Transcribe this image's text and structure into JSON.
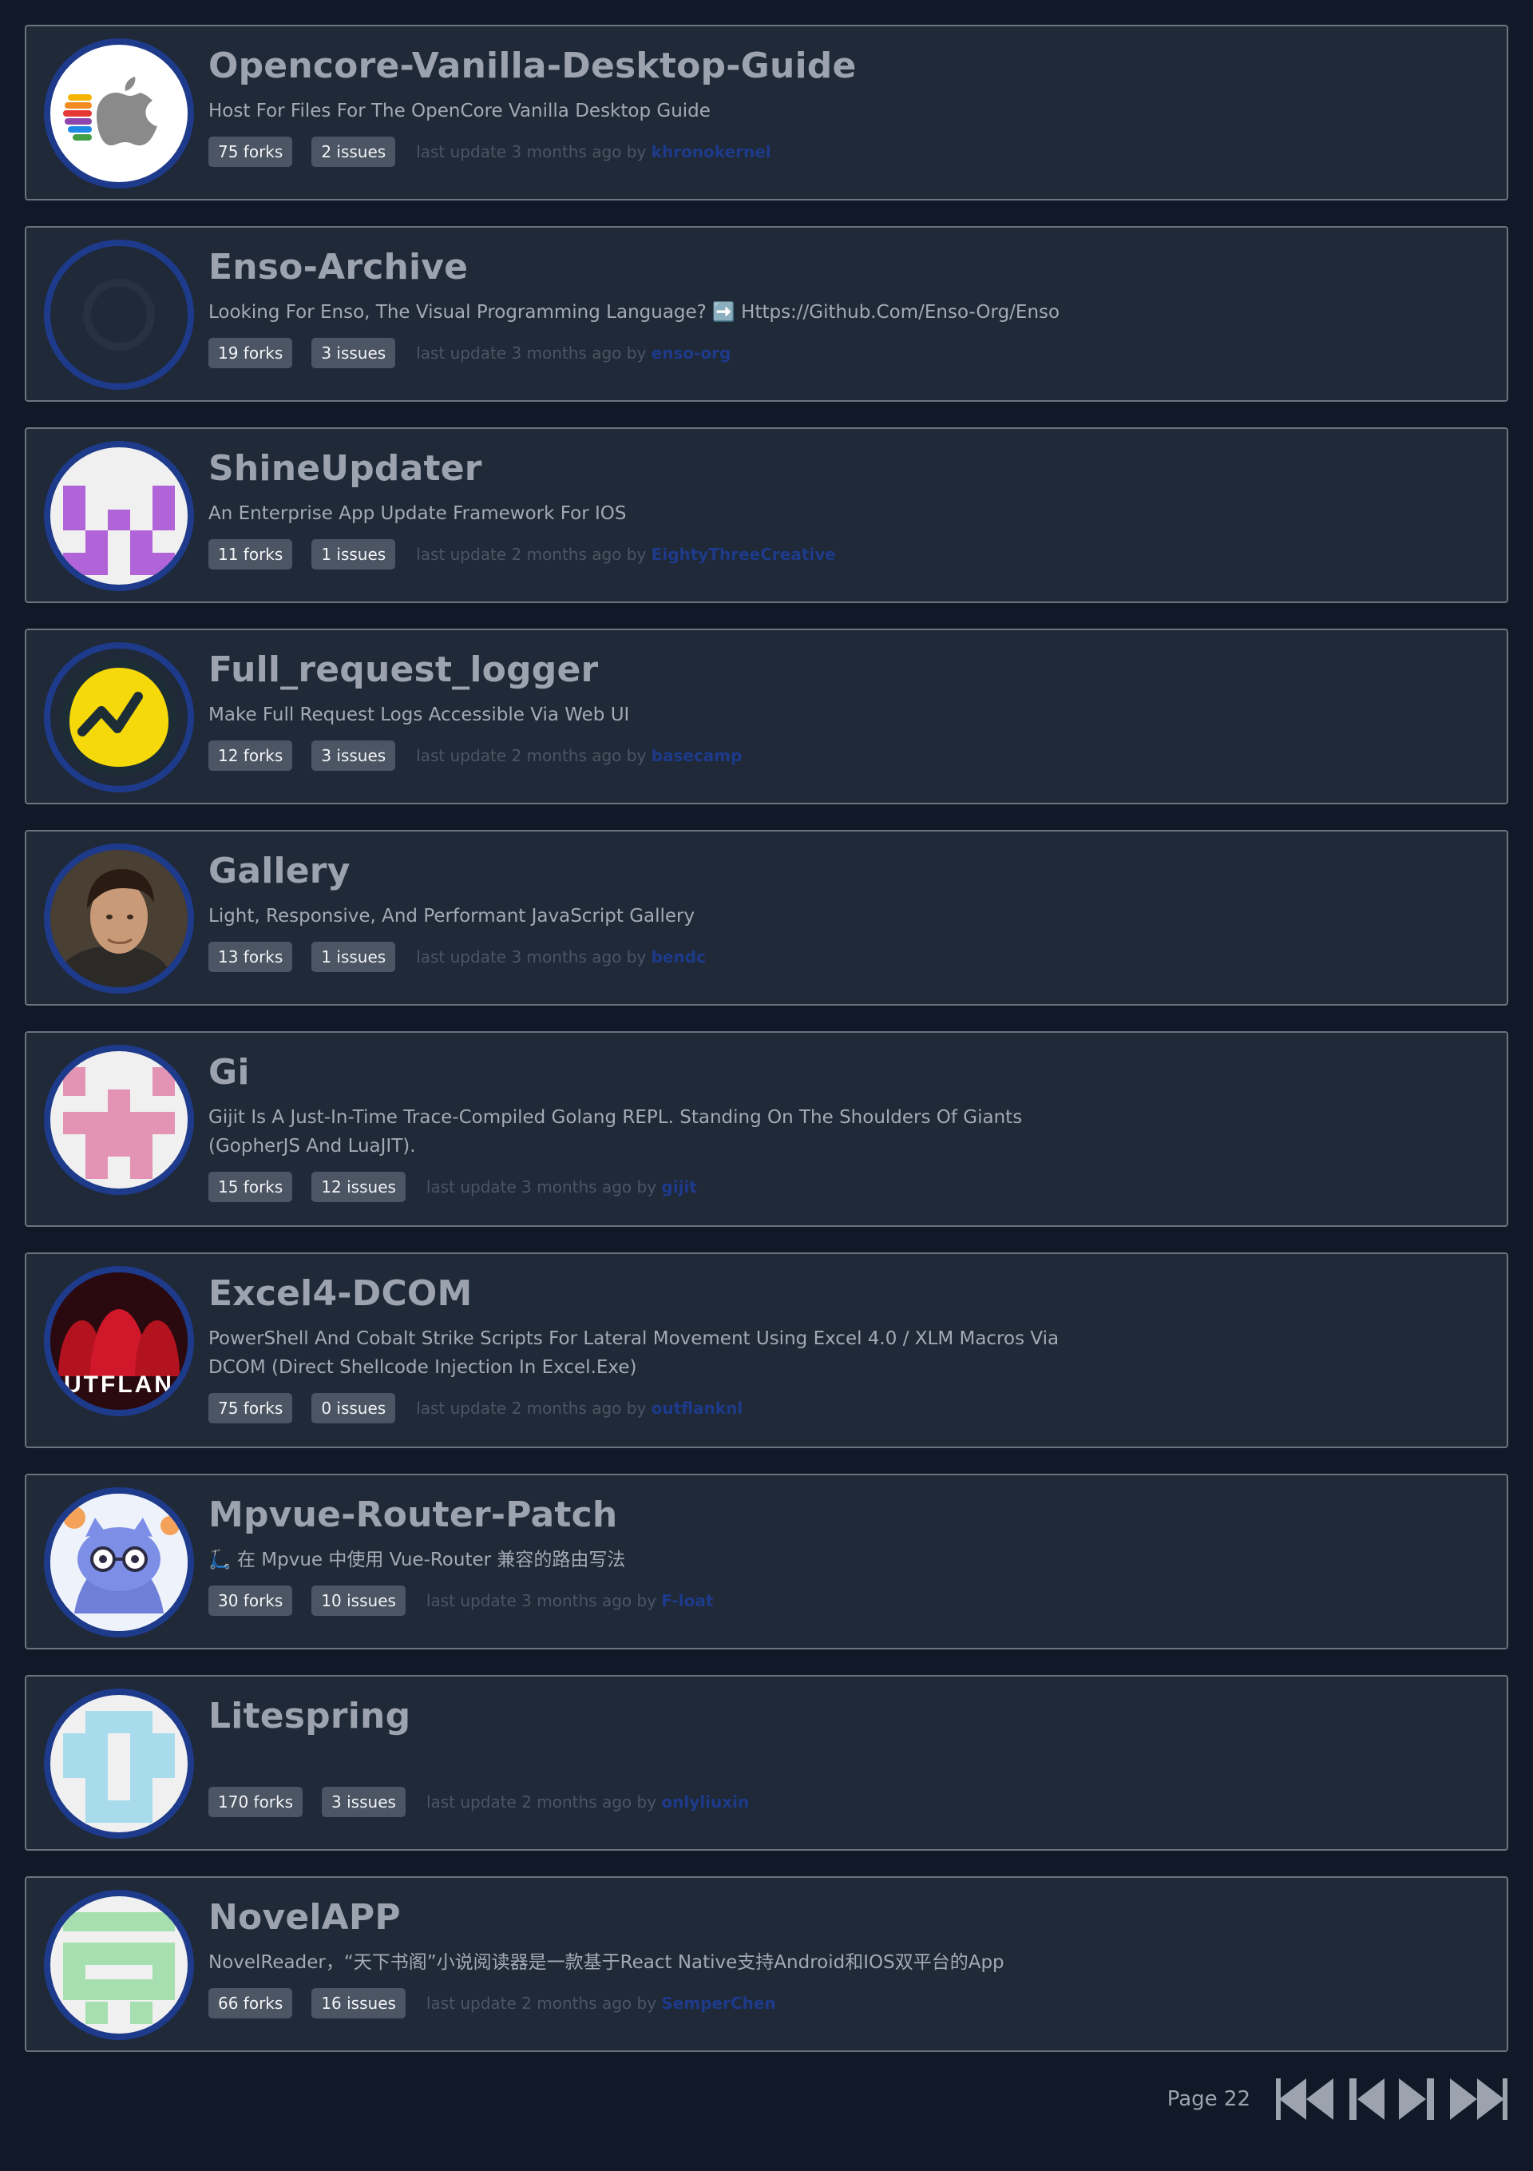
{
  "repos": [
    {
      "name": "Opencore-Vanilla-Desktop-Guide",
      "description": "Host For Files For The OpenCore Vanilla Desktop Guide",
      "forks": "75 forks",
      "issues": "2 issues",
      "update": "last update 3 months ago by ",
      "author": "khronokernel",
      "avatar_icon": "apple-logo-icon"
    },
    {
      "name": "Enso-Archive",
      "description": "Looking For Enso, The Visual Programming Language? ➡️ Https://Github.Com/Enso-Org/Enso",
      "forks": "19 forks",
      "issues": "3 issues",
      "update": "last update 3 months ago by ",
      "author": "enso-org",
      "avatar_icon": "enso-logo-icon"
    },
    {
      "name": "ShineUpdater",
      "description": "An Enterprise App Update Framework For IOS",
      "forks": "11 forks",
      "issues": "1 issues",
      "update": "last update 2 months ago by ",
      "author": "EightyThreeCreative",
      "avatar_icon": "identicon-purple-icon"
    },
    {
      "name": "Full_request_logger",
      "description": "Make Full Request Logs Accessible Via Web UI",
      "forks": "12 forks",
      "issues": "3 issues",
      "update": "last update 2 months ago by ",
      "author": "basecamp",
      "avatar_icon": "basecamp-logo-icon"
    },
    {
      "name": "Gallery",
      "description": "Light, Responsive, And Performant JavaScript Gallery",
      "forks": "13 forks",
      "issues": "1 issues",
      "update": "last update 3 months ago by ",
      "author": "bendc",
      "avatar_icon": "user-photo-icon"
    },
    {
      "name": "Gi",
      "description": "Gijit Is A Just-In-Time Trace-Compiled Golang REPL. Standing On The Shoulders Of Giants (GopherJS And LuaJIT).",
      "forks": "15 forks",
      "issues": "12 issues",
      "update": "last update 3 months ago by ",
      "author": "gijit",
      "avatar_icon": "identicon-pink-icon"
    },
    {
      "name": "Excel4-DCOM",
      "description": "PowerShell And Cobalt Strike Scripts For Lateral Movement Using Excel 4.0 / XLM Macros Via DCOM (Direct Shellcode Injection In Excel.Exe)",
      "forks": "75 forks",
      "issues": "0 issues",
      "update": "last update 2 months ago by ",
      "author": "outflanknl",
      "avatar_icon": "outflank-logo-icon"
    },
    {
      "name": "Mpvue-Router-Patch",
      "description": "🛴 在 Mpvue 中使用 Vue-Router 兼容的路由写法",
      "forks": "30 forks",
      "issues": "10 issues",
      "update": "last update 3 months ago by ",
      "author": "F-loat",
      "avatar_icon": "cartoon-cat-icon"
    },
    {
      "name": "Litespring",
      "description": "",
      "forks": "170 forks",
      "issues": "3 issues",
      "update": "last update 2 months ago by ",
      "author": "onlyliuxin",
      "avatar_icon": "identicon-blue-icon"
    },
    {
      "name": "NovelAPP",
      "description": "NovelReader，“天下书阁”小说阅读器是一款基于React Native支持Android和IOS双平台的App",
      "forks": "66 forks",
      "issues": "16 issues",
      "update": "last update 2 months ago by ",
      "author": "SemperChen",
      "avatar_icon": "identicon-green-icon"
    }
  ],
  "pagination": {
    "label": "Page 22",
    "buttons": [
      "first-page-icon",
      "previous-page-icon",
      "next-page-icon",
      "last-page-icon"
    ]
  },
  "colors": {
    "background": "#111827",
    "card": "#1f2937",
    "badge": "#4b5563",
    "author_link": "#1e3a8a",
    "avatar_ring": "#1e3a8a"
  }
}
